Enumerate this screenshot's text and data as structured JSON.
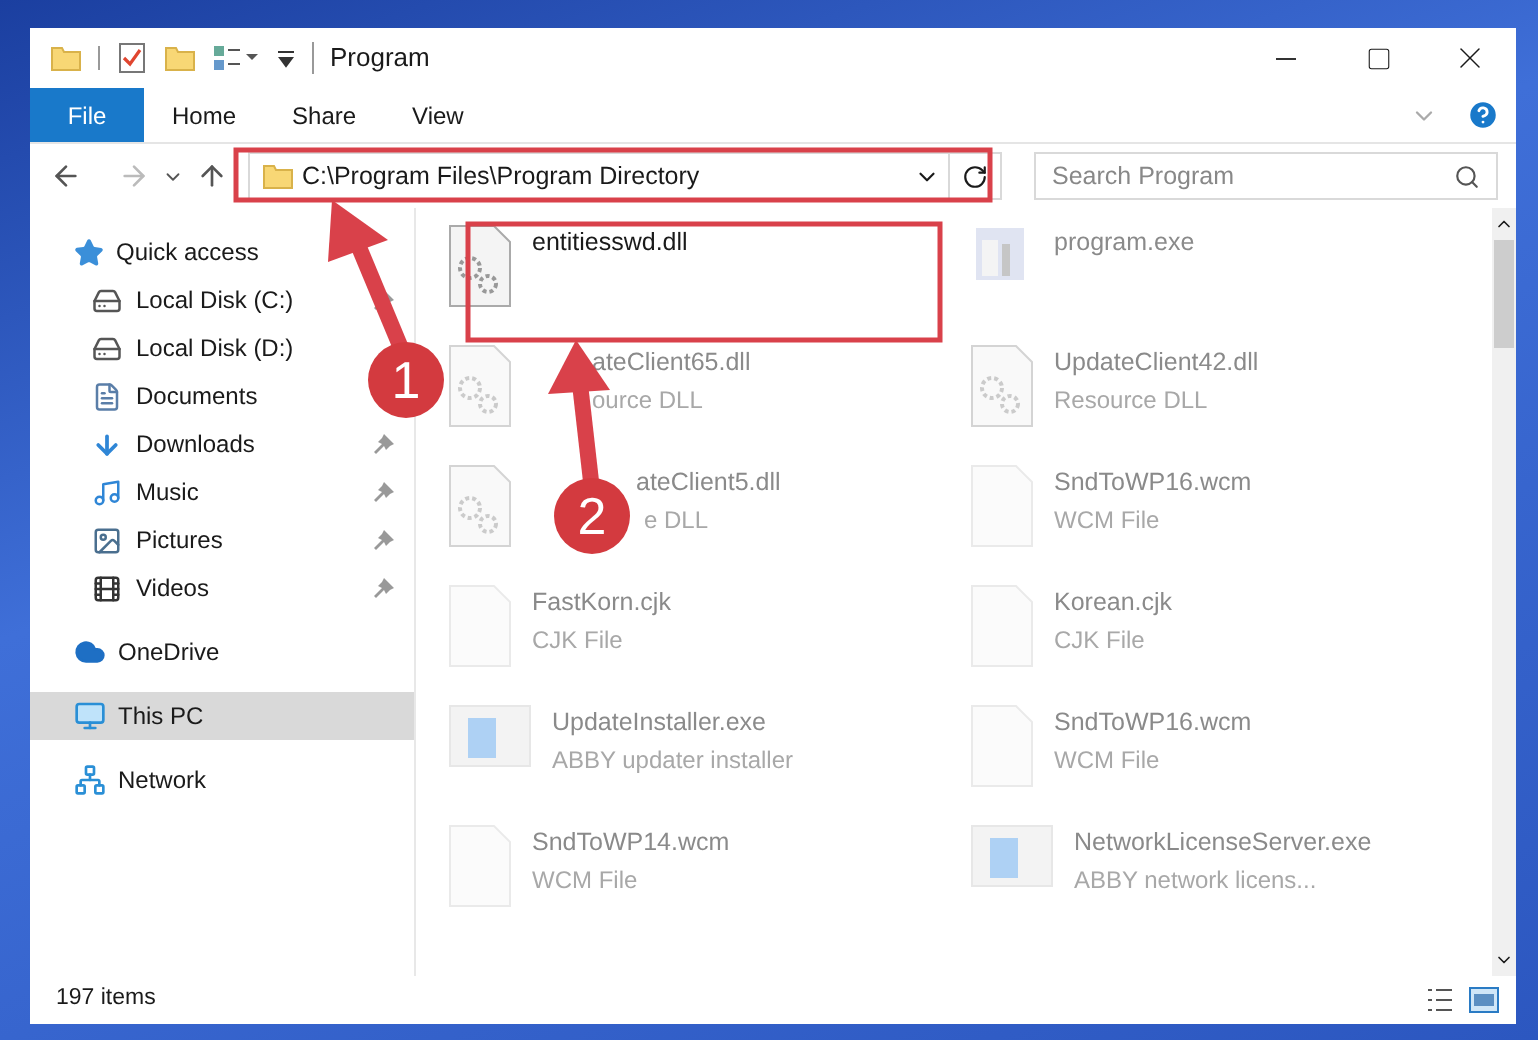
{
  "window": {
    "title": "Program"
  },
  "ribbon": {
    "file_menu": "File",
    "tabs": [
      "Home",
      "Share",
      "View"
    ]
  },
  "address": {
    "path": "C:\\Program Files\\Program Directory"
  },
  "search": {
    "placeholder": "Search Program"
  },
  "sidebar": {
    "items": [
      {
        "label": "Quick access",
        "selected": false,
        "children": [
          {
            "label": "Local Disk (C:)",
            "pinned": true
          },
          {
            "label": "Local Disk (D:)",
            "pinned": false
          },
          {
            "label": "Documents",
            "pinned": false
          },
          {
            "label": "Downloads",
            "pinned": true
          },
          {
            "label": "Music",
            "pinned": true
          },
          {
            "label": "Pictures",
            "pinned": true
          },
          {
            "label": "Videos",
            "pinned": true
          }
        ]
      },
      {
        "label": "OneDrive",
        "selected": false
      },
      {
        "label": "This PC",
        "selected": true
      },
      {
        "label": "Network",
        "selected": false
      }
    ]
  },
  "files": [
    {
      "name": "entitiesswd.dll",
      "kind": "dll",
      "faded": false
    },
    {
      "name": "program.exe",
      "kind": "exe",
      "faded": true
    },
    {
      "name": "ateClient65.dll",
      "type": "ource DLL",
      "kind": "dll",
      "faded": true
    },
    {
      "name": "UpdateClient42.dll",
      "type": "Resource DLL",
      "kind": "dll",
      "faded": true
    },
    {
      "name": "ateClient5.dll",
      "type": "e DLL",
      "kind": "dll",
      "faded": true
    },
    {
      "name": "SndToWP16.wcm",
      "type": "WCM File",
      "kind": "doc",
      "faded": true
    },
    {
      "name": "FastKorn.cjk",
      "type": "CJK File",
      "kind": "doc",
      "faded": true
    },
    {
      "name": "Korean.cjk",
      "type": "CJK File",
      "kind": "doc",
      "faded": true
    },
    {
      "name": "UpdateInstaller.exe",
      "type": "ABBY updater installer",
      "kind": "installer",
      "faded": true
    },
    {
      "name": "SndToWP16.wcm",
      "type": "WCM File",
      "kind": "doc",
      "faded": true
    },
    {
      "name": "SndToWP14.wcm",
      "type": "WCM File",
      "kind": "doc",
      "faded": true
    },
    {
      "name": "NetworkLicenseServer.exe",
      "type": "ABBY network licens...",
      "kind": "installer",
      "faded": true
    }
  ],
  "status_bar": {
    "count": "197 items"
  },
  "annotations": [
    {
      "number": "1"
    },
    {
      "number": "2"
    }
  ]
}
